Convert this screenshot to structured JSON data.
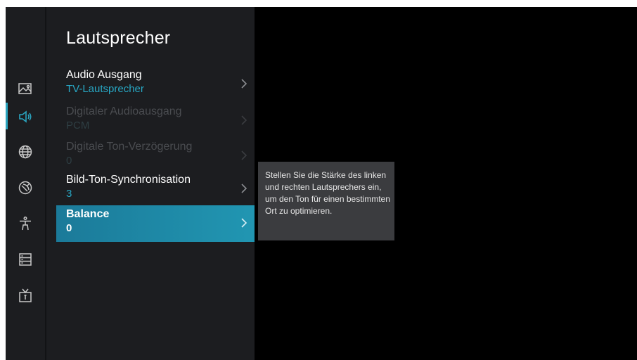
{
  "panel": {
    "title": "Lautsprecher"
  },
  "menu": [
    {
      "label": "Audio Ausgang",
      "value": "TV-Lautsprecher",
      "state": "normal"
    },
    {
      "label": "Digitaler Audioausgang",
      "value": "PCM",
      "state": "disabled"
    },
    {
      "label": "Digitale Ton-Verzögerung",
      "value": "0",
      "state": "disabled"
    },
    {
      "label": "Bild-Ton-Synchronisation",
      "value": "3",
      "state": "normal"
    },
    {
      "label": "Balance",
      "value": "0",
      "state": "selected"
    }
  ],
  "tooltip": {
    "text": "Stellen Sie die Stärke des linken und rechten Lautsprechers ein, um den Ton für einen bestimmten Ort zu optimieren."
  },
  "rail": {
    "icons": [
      "picture-icon",
      "speaker-icon",
      "globe-icon",
      "satellite-icon",
      "accessibility-icon",
      "system-icon",
      "tv-icon"
    ],
    "active_index": 1
  },
  "colors": {
    "accent": "#28a7c4",
    "panel_bg": "#1c1d20",
    "screen_bg": "#000000",
    "tooltip_bg": "#3b3c3f"
  }
}
